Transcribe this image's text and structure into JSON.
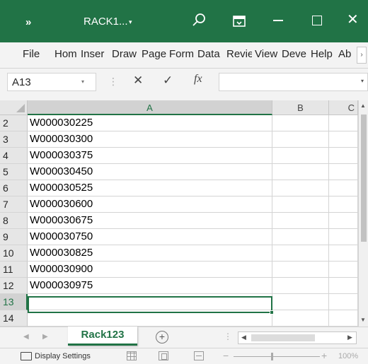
{
  "title_bar": {
    "overflow_label": "»",
    "document_name": "RACK1...",
    "document_menu_arrow": "▾",
    "icons": [
      "search-icon",
      "ribbon-display-icon",
      "minimize-icon",
      "maximize-icon",
      "close-icon"
    ],
    "close_glyph": "✕",
    "background": "#217346"
  },
  "ribbon_tabs": [
    "File",
    "Hom",
    "Inser",
    "Draw",
    "Page",
    "Form",
    "Data",
    "Revie",
    "View",
    "Deve",
    "Help",
    "Ab"
  ],
  "ribbon_scroll_glyph": "›",
  "formula_bar": {
    "name_box": "A13",
    "name_box_arrow": "▾",
    "dots": "⋮",
    "cancel_glyph": "✕",
    "enter_glyph": "✓",
    "fx_label": "fx",
    "formula_value": "",
    "expand_glyph": "▾"
  },
  "grid": {
    "columns": [
      "A",
      "B",
      "C"
    ],
    "selected_column": "A",
    "rows": [
      {
        "num": "2",
        "a": "W000030225"
      },
      {
        "num": "3",
        "a": "W000030300"
      },
      {
        "num": "4",
        "a": "W000030375"
      },
      {
        "num": "5",
        "a": "W000030450"
      },
      {
        "num": "6",
        "a": "W000030525"
      },
      {
        "num": "7",
        "a": "W000030600"
      },
      {
        "num": "8",
        "a": "W000030675"
      },
      {
        "num": "9",
        "a": "W000030750"
      },
      {
        "num": "10",
        "a": "W000030825"
      },
      {
        "num": "11",
        "a": "W000030900"
      },
      {
        "num": "12",
        "a": "W000030975"
      },
      {
        "num": "13",
        "a": ""
      },
      {
        "num": "14",
        "a": ""
      }
    ],
    "active_row": "13"
  },
  "scroll_glyphs": {
    "up": "▲",
    "down": "▼",
    "left": "◀",
    "right": "▶"
  },
  "sheet_bar": {
    "prev_glyph": "◀",
    "next_glyph": "▶",
    "active_sheet": "Rack123",
    "add_sheet_glyph": "+",
    "dots": "⋮"
  },
  "status_bar": {
    "display_settings": "Display Settings",
    "zoom_minus": "−",
    "zoom_plus": "+",
    "zoom": "100%"
  }
}
